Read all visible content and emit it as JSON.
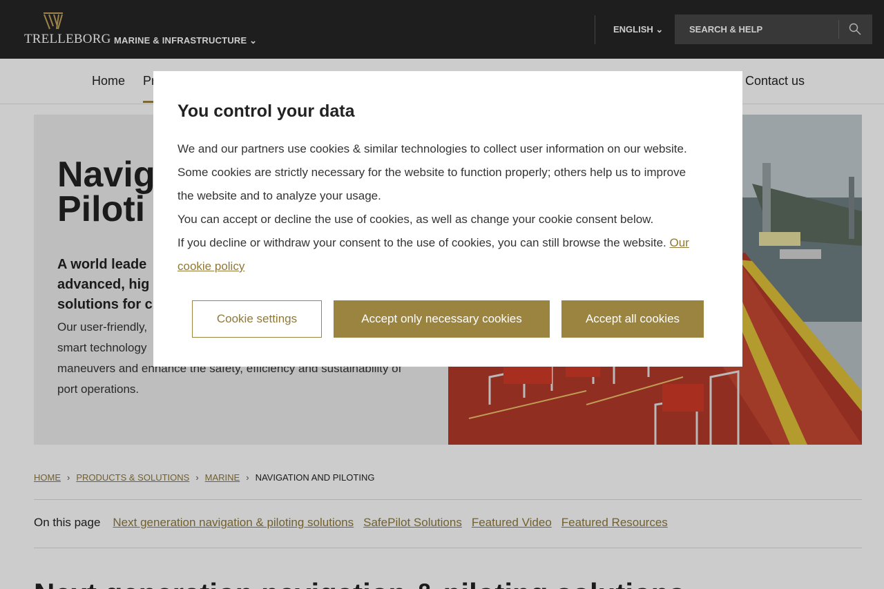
{
  "header": {
    "brand": "TRELLEBORG",
    "division": "MARINE & INFRASTRUCTURE ⌄",
    "language": "ENGLISH ⌄",
    "search_label": "SEARCH & HELP"
  },
  "nav": {
    "items": [
      "Home",
      "Pr",
      "Contact us"
    ]
  },
  "hero": {
    "title_line1": "Navig",
    "title_line2": "Piloti",
    "subtitle_lines": [
      "A world leade",
      "advanced, hig",
      "solutions for c"
    ],
    "body_lines": [
      "Our user-friendly,",
      "smart technology",
      "maneuvers and enhance the safety, efficiency and sustainability of",
      "port operations."
    ]
  },
  "breadcrumb": {
    "items": [
      "HOME",
      "PRODUCTS & SOLUTIONS",
      "MARINE"
    ],
    "current": "NAVIGATION AND PILOTING",
    "separator": "›"
  },
  "on_this_page": {
    "label": "On this page",
    "links": [
      "Next generation navigation & piloting solutions",
      "SafePilot Solutions",
      "Featured Video",
      "Featured Resources"
    ]
  },
  "section_title": "Next generation navigation & piloting solutions",
  "cookie_modal": {
    "title": "You control your data",
    "line1": "We and our partners use cookies & similar technologies to collect user information on our website.",
    "line2": "Some cookies are strictly necessary for the website to function properly; others help us to improve",
    "line3": "the website and to analyze your usage.",
    "line4": "You can accept or decline the use of cookies, as well as change your cookie consent below.",
    "line5": "If you decline or withdraw your consent to the use of cookies, you can still browse the website.",
    "policy_link_part1": "Our",
    "policy_link_part2": "cookie policy",
    "buttons": {
      "settings": "Cookie settings",
      "necessary": "Accept only necessary cookies",
      "all": "Accept all cookies"
    }
  },
  "colors": {
    "accent": "#9b8340",
    "topbar": "#262626",
    "search_bg": "#474747"
  }
}
